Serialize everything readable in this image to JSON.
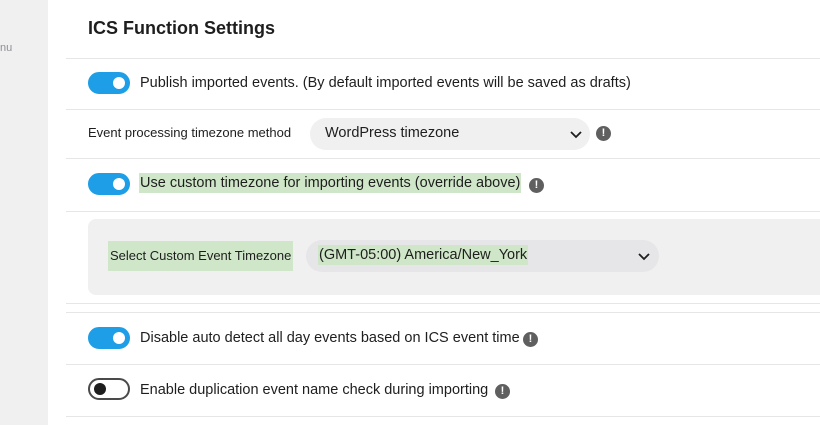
{
  "sidebar": {
    "fragment": "nu"
  },
  "panel": {
    "title": "ICS Function Settings"
  },
  "settings": {
    "publish": {
      "label": "Publish imported events. (By default imported events will be saved as drafts)",
      "enabled": true
    },
    "tz_method": {
      "label": "Event processing timezone method",
      "value": "WordPress timezone"
    },
    "custom_tz": {
      "label": "Use custom timezone for importing events (override above)",
      "enabled": true
    },
    "custom_tz_select": {
      "label": "Select Custom Event Timezone",
      "value": "(GMT-05:00) America/New_York"
    },
    "auto_detect": {
      "label": "Disable auto detect all day events based on ICS event time",
      "enabled": true
    },
    "dup_check": {
      "label": "Enable duplication event name check during importing",
      "enabled": false
    }
  },
  "icons": {
    "help": "!"
  },
  "colors": {
    "toggle_on": "#1e9ee6",
    "highlight": "#cfe7c8"
  }
}
